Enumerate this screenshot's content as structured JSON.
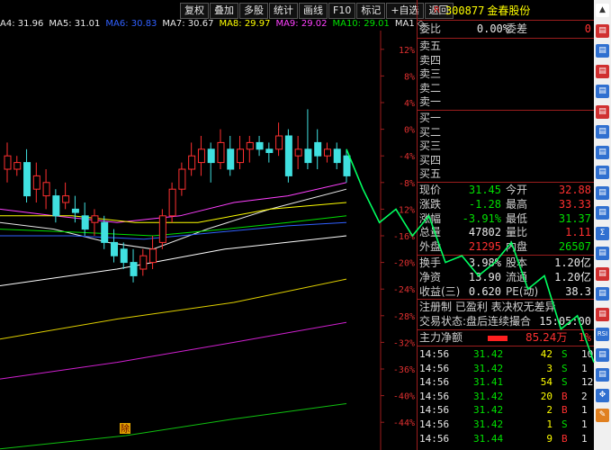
{
  "toolbar": {
    "buttons": [
      "复权",
      "叠加",
      "多股",
      "统计",
      "画线",
      "F10",
      "标记",
      "+自选",
      "返回"
    ]
  },
  "ma_row": {
    "items": [
      {
        "label": "A4: 31.96",
        "color": "#e8e8e8"
      },
      {
        "label": "MA5: 31.01",
        "color": "#e8e8e8"
      },
      {
        "label": "MA6: 30.83",
        "color": "#3060ff"
      },
      {
        "label": "MA7: 30.67",
        "color": "#e8e8e8"
      },
      {
        "label": "MA8: 29.97",
        "color": "#ffff00"
      },
      {
        "label": "MA9: 29.02",
        "color": "#ff40ff"
      },
      {
        "label": "MA10: 29.01",
        "color": "#00e000"
      },
      {
        "label": "MA1 ◇",
        "color": "#e8e8e8"
      }
    ]
  },
  "chart_data": {
    "type": "candlestick",
    "ylabel": "",
    "yticks": [
      "12%",
      "8%",
      "4%",
      "0%",
      "-4%",
      "-8%",
      "-12%",
      "-16%",
      "-20%",
      "-24%",
      "-28%",
      "-32%",
      "-36%",
      "-40%",
      "-44%"
    ],
    "ylim": [
      -46,
      14
    ],
    "annotation": "除",
    "candles": [
      {
        "o": -4,
        "c": -6,
        "h": -2,
        "l": -8,
        "up": true
      },
      {
        "o": -6,
        "c": -5,
        "h": -4,
        "l": -7,
        "up": true
      },
      {
        "o": -5,
        "c": -10,
        "h": -3,
        "l": -11,
        "up": false
      },
      {
        "o": -9,
        "c": -7,
        "h": -5,
        "l": -11,
        "up": true
      },
      {
        "o": -10,
        "c": -8,
        "h": -6,
        "l": -12,
        "up": true
      },
      {
        "o": -10,
        "c": -13,
        "h": -9,
        "l": -14,
        "up": false
      },
      {
        "o": -11,
        "c": -10,
        "h": -8,
        "l": -12,
        "up": true
      },
      {
        "o": -12,
        "c": -12.5,
        "h": -10,
        "l": -14,
        "up": false
      },
      {
        "o": -13,
        "c": -15,
        "h": -11,
        "l": -16,
        "up": false
      },
      {
        "o": -14,
        "c": -13,
        "h": -12,
        "l": -16,
        "up": true
      },
      {
        "o": -14,
        "c": -17,
        "h": -13,
        "l": -18,
        "up": false
      },
      {
        "o": -17,
        "c": -19,
        "h": -15,
        "l": -20,
        "up": false
      },
      {
        "o": -18,
        "c": -20,
        "h": -17,
        "l": -21,
        "up": false
      },
      {
        "o": -20,
        "c": -22,
        "h": -18,
        "l": -23,
        "up": false
      },
      {
        "o": -21,
        "c": -19,
        "h": -18,
        "l": -22,
        "up": true
      },
      {
        "o": -20,
        "c": -18,
        "h": -16,
        "l": -21,
        "up": true
      },
      {
        "o": -17,
        "c": -13,
        "h": -12,
        "l": -18,
        "up": true
      },
      {
        "o": -13,
        "c": -9,
        "h": -8,
        "l": -14,
        "up": true
      },
      {
        "o": -9,
        "c": -6,
        "h": -5,
        "l": -10,
        "up": true
      },
      {
        "o": -6,
        "c": -4,
        "h": -2,
        "l": -7,
        "up": true
      },
      {
        "o": -5,
        "c": -3,
        "h": -1,
        "l": -7,
        "up": true
      },
      {
        "o": -3,
        "c": -5,
        "h": -2,
        "l": -8,
        "up": false
      },
      {
        "o": -5,
        "c": -2,
        "h": 0,
        "l": -6,
        "up": true
      },
      {
        "o": -3,
        "c": -6,
        "h": -1,
        "l": -7,
        "up": false
      },
      {
        "o": -5,
        "c": -3,
        "h": -1,
        "l": -6,
        "up": true
      },
      {
        "o": -3,
        "c": -2,
        "h": -1,
        "l": -5,
        "up": true
      },
      {
        "o": -2,
        "c": -3,
        "h": -1,
        "l": -4,
        "up": false
      },
      {
        "o": -3,
        "c": -3.5,
        "h": -2,
        "l": -5,
        "up": false
      },
      {
        "o": -3,
        "c": -1,
        "h": 1,
        "l": -4,
        "up": true
      },
      {
        "o": -1,
        "c": -7,
        "h": 0,
        "l": -8,
        "up": false
      },
      {
        "o": -4,
        "c": -3,
        "h": -1,
        "l": -6,
        "up": true
      },
      {
        "o": -3,
        "c": -5,
        "h": 3,
        "l": -6,
        "up": false
      },
      {
        "o": -2,
        "c": -4,
        "h": 0,
        "l": -6,
        "up": false
      },
      {
        "o": -4,
        "c": -3,
        "h": -2,
        "l": -5,
        "up": true
      },
      {
        "o": -3,
        "c": -5,
        "h": -2,
        "l": -6,
        "up": false
      },
      {
        "o": -4,
        "c": -7,
        "h": -3,
        "l": -8,
        "up": false
      }
    ],
    "forecast_line": [
      [
        -3,
        0
      ],
      [
        -9,
        1
      ],
      [
        -14,
        2
      ],
      [
        -12,
        3
      ],
      [
        -16,
        4
      ],
      [
        -13,
        5
      ],
      [
        -20,
        6
      ],
      [
        -19,
        7
      ],
      [
        -22,
        8
      ],
      [
        -20,
        9
      ],
      [
        -17,
        10
      ],
      [
        -24,
        11
      ],
      [
        -22,
        12
      ],
      [
        -30,
        13
      ],
      [
        -28,
        14
      ],
      [
        -35,
        15
      ]
    ]
  },
  "quote": {
    "badge": "R",
    "code": "300877",
    "name": "金春股份",
    "weibi": {
      "label": "委比",
      "value": "0.00%",
      "label2": "委差",
      "value2": "0"
    },
    "sells": [
      "卖五",
      "卖四",
      "卖三",
      "卖二",
      "卖一"
    ],
    "buys": [
      "买一",
      "买二",
      "买三",
      "买四",
      "买五"
    ],
    "stats": [
      {
        "l": "现价",
        "v": "31.45",
        "l2": "今开",
        "v2": "32.88"
      },
      {
        "l": "涨跌",
        "v": "-1.28",
        "l2": "最高",
        "v2": "33.33"
      },
      {
        "l": "涨幅",
        "v": "-3.91%",
        "l2": "最低",
        "v2": "31.37"
      },
      {
        "l": "总量",
        "v": "47802",
        "l2": "量比",
        "v2": "1.11"
      },
      {
        "l": "外盘",
        "v": "21295",
        "l2": "内盘",
        "v2": "26507"
      }
    ],
    "stats2": [
      {
        "l": "换手",
        "v": "3.98%",
        "l2": "股本",
        "v2": "1.20亿"
      },
      {
        "l": "净资",
        "v": "13.90",
        "l2": "流通",
        "v2": "1.20亿"
      },
      {
        "l": "收益(三)",
        "v": "0.620",
        "l2": "PE(动)",
        "v2": "38.3"
      }
    ],
    "status1": "注册制 已盈利 表决权无差异",
    "status2_label": "交易状态:盘后连续撮合",
    "status2_time": "15:05:00",
    "main_flow": {
      "label": "主力净额",
      "value": "85.24万",
      "pct": "1%"
    },
    "trades": [
      {
        "t": "14:56",
        "p": "31.42",
        "v": "42",
        "s": "S",
        "n": "10"
      },
      {
        "t": "14:56",
        "p": "31.42",
        "v": "3",
        "s": "S",
        "n": "1"
      },
      {
        "t": "14:56",
        "p": "31.41",
        "v": "54",
        "s": "S",
        "n": "12"
      },
      {
        "t": "14:56",
        "p": "31.42",
        "v": "20",
        "s": "B",
        "n": "2"
      },
      {
        "t": "14:56",
        "p": "31.42",
        "v": "2",
        "s": "B",
        "n": "1"
      },
      {
        "t": "14:56",
        "p": "31.42",
        "v": "1",
        "s": "S",
        "n": "1"
      },
      {
        "t": "14:56",
        "p": "31.44",
        "v": "9",
        "s": "B",
        "n": "1"
      }
    ]
  },
  "sidebar": {
    "icons": [
      "arrow-up-icon",
      "chart-icon",
      "grid-icon",
      "chart-icon",
      "bar-chart-icon",
      "kline-icon",
      "fund-icon",
      "list-icon",
      "info-icon",
      "doc-icon",
      "doc-icon",
      "sigma-icon",
      "table-icon",
      "chart-icon",
      "chart-icon",
      "chart-icon",
      "rsi-icon",
      "chart-icon",
      "chart-icon",
      "move-icon",
      "pencil-icon"
    ],
    "rsi_label": "RSI"
  }
}
